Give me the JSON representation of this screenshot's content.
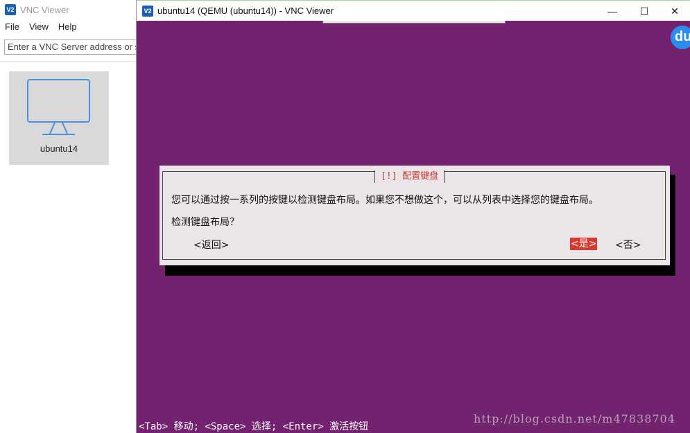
{
  "main_window": {
    "title": "VNC Viewer",
    "icon": "vnc-logo-icon",
    "menu": [
      "File",
      "View",
      "Help"
    ],
    "address_placeholder": "Enter a VNC Server address or s",
    "server_tile": {
      "name": "ubuntu14",
      "icon": "monitor-icon"
    }
  },
  "session_window": {
    "title": "ubuntu14 (QEMU (ubuntu14)) - VNC Viewer",
    "controls": {
      "minimize": "—",
      "maximize": "☐",
      "close": "✕"
    },
    "badge": "du"
  },
  "dialog": {
    "title": "[!] 配置键盘",
    "message": "您可以通过按一系列的按键以检测键盘布局。如果您不想做这个，可以从列表中选择您的键盘布局。",
    "question": "检测键盘布局？",
    "back_label": "<返回>",
    "yes_label": "<是>",
    "no_label": "<否>"
  },
  "help_line": "<Tab> 移动; <Space> 选择; <Enter> 激活按钮",
  "watermark": "http://blog.csdn.net/m47838704",
  "colors": {
    "desktop_bg": "#72226f",
    "dialog_bg": "#e9e5e9",
    "accent_red": "#d9382f",
    "tile_bg": "#d9d9d9"
  }
}
